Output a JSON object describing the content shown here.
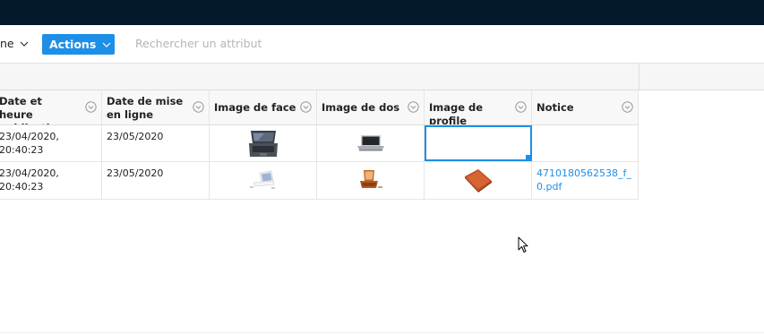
{
  "toolbar": {
    "view_label": "ne",
    "actions_label": "Actions",
    "search_placeholder": "Rechercher un attribut"
  },
  "table": {
    "columns": [
      {
        "label": "Date et heure publication"
      },
      {
        "label": "Date de mise en ligne"
      },
      {
        "label": "Image de face"
      },
      {
        "label": "Image de dos"
      },
      {
        "label": "Image de profile"
      },
      {
        "label": "Notice"
      }
    ],
    "rows": [
      {
        "publication": "23/04/2020, 20:40:23",
        "mise_en_ligne": "23/05/2020",
        "image_face": "laptop-dark-image",
        "image_dos": "laptop-silver-image",
        "image_profile": "",
        "notice": ""
      },
      {
        "publication": "23/04/2020, 20:40:23",
        "mise_en_ligne": "23/05/2020",
        "image_face": "laptop-white-image",
        "image_dos": "laptop-orange-image",
        "image_profile": "laptop-orange-closed-image",
        "notice": "4710180562538_f_0.pdf"
      }
    ]
  },
  "colors": {
    "topbar": "#03182b",
    "accent": "#1e8fe6"
  },
  "icons": {
    "view_chevron": "chevron-down-icon",
    "actions_chevron": "chevron-down-icon",
    "column_menu": "chevron-circle-icon",
    "cursor": "mouse-pointer-icon"
  }
}
